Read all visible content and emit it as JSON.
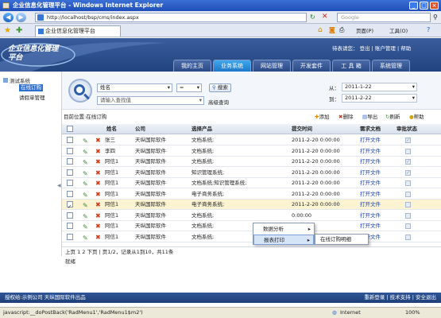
{
  "window": {
    "title": "企业信息化管理平台 - Windows Internet Explorer"
  },
  "browser": {
    "url": "http://localhost/bsp/cms/index.aspx",
    "search_placeholder": "Google",
    "tab_title": "企业信息化管理平台",
    "tools": {
      "page": "页面(P)",
      "tools": "工具(O)"
    }
  },
  "app": {
    "logo_text": "企业信息化管理平台",
    "welcome": "待表请您：",
    "top_links": [
      "登出",
      "账户管理",
      "帮助"
    ],
    "nav": [
      "我的主页",
      "业务系统",
      "网站管理",
      "开发套件",
      "工 具 箱",
      "系统管理"
    ],
    "nav_active_index": 1
  },
  "sidebar": {
    "root": "测试系统",
    "items": [
      "在线订购",
      "请假单管理"
    ]
  },
  "search": {
    "field": "姓名",
    "operator": "=",
    "button": "搜索",
    "placeholder": "请输入查找值",
    "advanced": "高级查询",
    "from_label": "从：",
    "from_value": "2011-1-22",
    "to_label": "到：",
    "to_value": "2011-2-22"
  },
  "toolbar": {
    "location": "目前位置:在线订购",
    "add": "添加",
    "delete": "删除",
    "export": "导出",
    "refresh": "刷新",
    "help": "帮助"
  },
  "table": {
    "headers": [
      "姓名",
      "公司",
      "选择产品",
      "提交时间",
      "需求文档",
      "审批状态"
    ],
    "rows": [
      {
        "name": "张三",
        "company": "天纵国际软件",
        "product": "文档系统;",
        "time": "2011-2-20 0:00:00",
        "doc": "打开文件",
        "checked": true
      },
      {
        "name": "李四",
        "company": "天纵国际软件",
        "product": "文档系统;",
        "time": "2011-2-20 0:00:00",
        "doc": "打开文件",
        "checked": false
      },
      {
        "name": "阿信1",
        "company": "天纵国际软件",
        "product": "文档系统;",
        "time": "2011-2-20 0:00:00",
        "doc": "打开文件",
        "checked": true
      },
      {
        "name": "阿信1",
        "company": "天纵国际软件",
        "product": "知识管理系统;",
        "time": "2011-2-20 0:00:00",
        "doc": "打开文件",
        "checked": true
      },
      {
        "name": "阿信1",
        "company": "天纵国际软件",
        "product": "文档系统;知识管理系统;",
        "time": "2011-2-20 0:00:00",
        "doc": "打开文件",
        "checked": false
      },
      {
        "name": "阿信1",
        "company": "天纵国际软件",
        "product": "电子商务系统;",
        "time": "2011-2-20 0:00:00",
        "doc": "打开文件",
        "checked": false
      },
      {
        "name": "阿信1",
        "company": "天纵国际软件",
        "product": "电子商务系统;",
        "time": "2011-2-20 0:00:00",
        "doc": "打开文件",
        "checked": false,
        "selected": true
      },
      {
        "name": "阿信1",
        "company": "天纵国际软件",
        "product": "文档系统;",
        "time": "0:00:00",
        "doc": "打开文件",
        "checked": false
      },
      {
        "name": "阿信1",
        "company": "天纵国际软件",
        "product": "文档系统;",
        "time": "0:00:00",
        "doc": "打开文件",
        "checked": false
      },
      {
        "name": "阿信1",
        "company": "天纵国际软件",
        "product": "文档系统;",
        "time": "2011-2-20 0:00:00",
        "doc": "打开文件",
        "checked": false
      }
    ]
  },
  "context_menu": {
    "items": [
      "数据分析",
      "报表打印"
    ],
    "submenu": [
      "在线订购明细"
    ]
  },
  "pager": {
    "text": "上页 1 2 下页  | 页1/2，记录从1到10，共11条",
    "status": "就绪"
  },
  "footer": {
    "left": "授权给:示例公司   天纵国际软件出品",
    "right": "重新登录 | 技术支持 | 安全退出"
  },
  "statusbar": {
    "script": "javascript:__doPostBack('RadMenu1','RadMenu1$m2')",
    "zone": "Internet",
    "zoom": "100%"
  },
  "colors": {
    "header": "#2b4f8e",
    "nav_active": "#2a8fdc",
    "footer": "#27498a"
  }
}
